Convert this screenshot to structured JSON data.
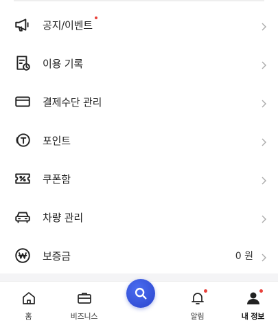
{
  "menu": [
    {
      "key": "notice",
      "label": "공지/이벤트",
      "icon": "megaphone-icon",
      "badge": true,
      "value": ""
    },
    {
      "key": "history",
      "label": "이용 기록",
      "icon": "receipt-clock-icon",
      "badge": false,
      "value": ""
    },
    {
      "key": "payment",
      "label": "결제수단 관리",
      "icon": "credit-card-icon",
      "badge": false,
      "value": ""
    },
    {
      "key": "points",
      "label": "포인트",
      "icon": "point-coin-icon",
      "badge": false,
      "value": ""
    },
    {
      "key": "coupon",
      "label": "쿠폰함",
      "icon": "coupon-icon",
      "badge": false,
      "value": ""
    },
    {
      "key": "vehicle",
      "label": "차량 관리",
      "icon": "car-icon",
      "badge": false,
      "value": ""
    },
    {
      "key": "deposit",
      "label": "보증금",
      "icon": "won-coin-icon",
      "badge": false,
      "value": "0 원"
    }
  ],
  "tabs": {
    "home": "홈",
    "business": "비즈니스",
    "alerts": "알림",
    "my_info": "내 정보"
  },
  "colors": {
    "accent": "#2f4fd8",
    "badge": "#e8413b"
  }
}
